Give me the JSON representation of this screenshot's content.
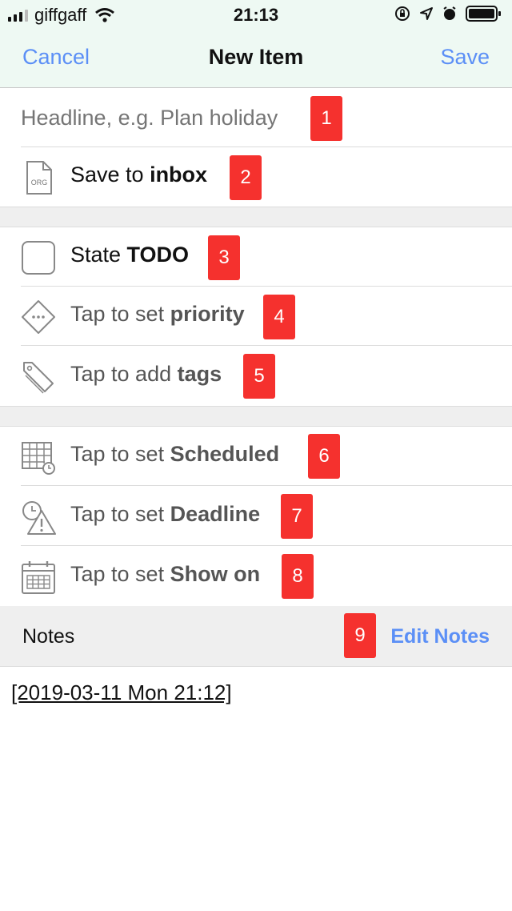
{
  "status_bar": {
    "carrier": "giffgaff",
    "time": "21:13"
  },
  "nav": {
    "cancel": "Cancel",
    "title": "New Item",
    "save": "Save"
  },
  "headline": {
    "placeholder": "Headline, e.g. Plan holiday"
  },
  "save_to": {
    "icon_text": "ORG",
    "prefix": "Save to ",
    "target": "inbox"
  },
  "state": {
    "prefix": "State ",
    "value": "TODO"
  },
  "priority": {
    "prefix": "Tap to set ",
    "value": "priority"
  },
  "tags": {
    "prefix": "Tap to add ",
    "value": "tags"
  },
  "scheduled": {
    "prefix": "Tap to set ",
    "value": "Scheduled"
  },
  "deadline": {
    "prefix": "Tap to set ",
    "value": "Deadline"
  },
  "show_on": {
    "prefix": "Tap to set ",
    "value": "Show on"
  },
  "notes": {
    "title": "Notes",
    "edit": "Edit Notes",
    "content": "[2019-03-11 Mon 21:12]"
  },
  "badges": [
    "1",
    "2",
    "3",
    "4",
    "5",
    "6",
    "7",
    "8",
    "9"
  ],
  "colors": {
    "accent": "#5b8ff6",
    "badge": "#f5312e",
    "header_bg": "#eef9f3"
  }
}
